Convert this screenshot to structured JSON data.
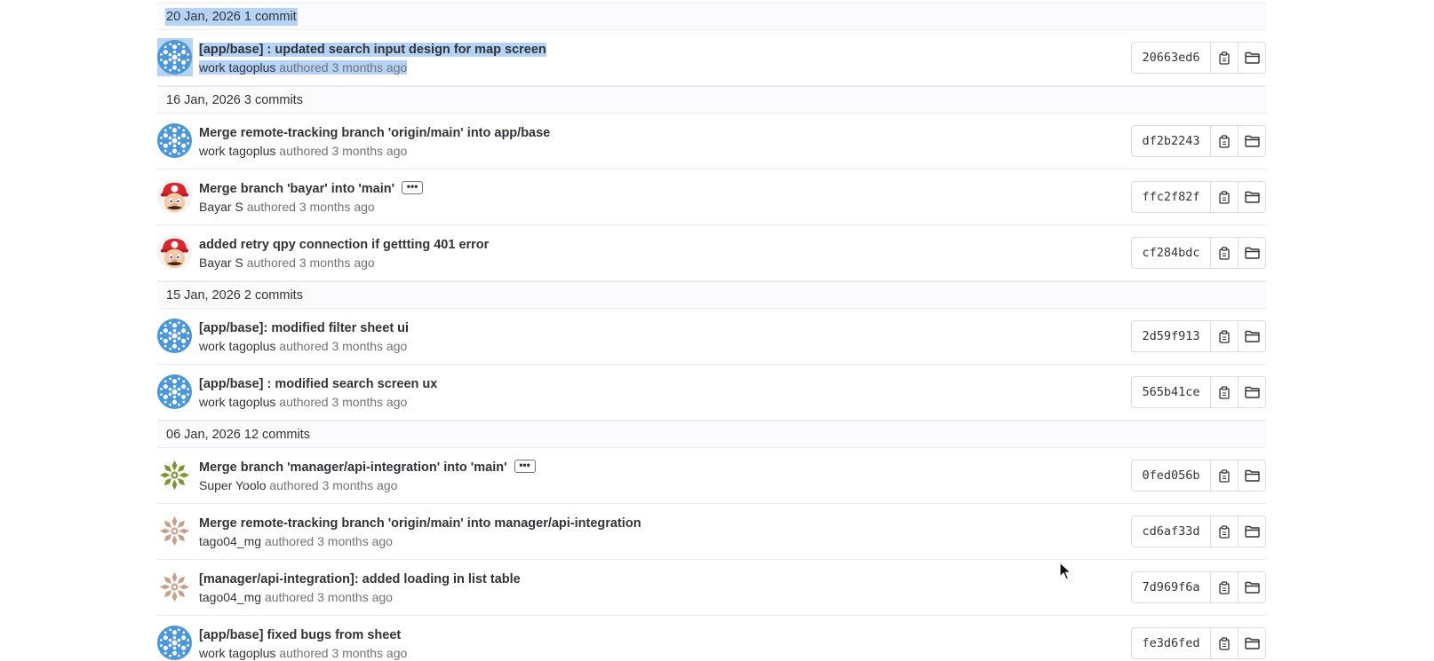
{
  "colors": {
    "selection": "#b4d3f5",
    "avatar_blue": "#4b97d8",
    "avatar_green": "#7d9431",
    "avatar_tan": "#c8a08a",
    "text_primary": "#333238",
    "text_secondary": "#737278"
  },
  "groups": [
    {
      "header": "20 Jan, 2026 1 commit",
      "commits": [
        {
          "title": "[app/base] : updated search input design for map screen",
          "author": "work tagoplus",
          "meta": "authored 3 months ago",
          "sha": "20663ed6",
          "avatar": "blue-snowflake",
          "ellipsis": false,
          "selected": true
        }
      ]
    },
    {
      "header": "16 Jan, 2026 3 commits",
      "commits": [
        {
          "title": "Merge remote-tracking branch 'origin/main' into app/base",
          "author": "work tagoplus",
          "meta": "authored 3 months ago",
          "sha": "df2b2243",
          "avatar": "blue-snowflake",
          "ellipsis": false
        },
        {
          "title": "Merge branch 'bayar' into 'main'",
          "author": "Bayar S",
          "meta": "authored 3 months ago",
          "sha": "ffc2f82f",
          "avatar": "mario",
          "ellipsis": true
        },
        {
          "title": "added retry qpy connection if gettting 401 error",
          "author": "Bayar S",
          "meta": "authored 3 months ago",
          "sha": "cf284bdc",
          "avatar": "mario",
          "ellipsis": false
        }
      ]
    },
    {
      "header": "15 Jan, 2026 2 commits",
      "commits": [
        {
          "title": "[app/base]: modified filter sheet ui",
          "author": "work tagoplus",
          "meta": "authored 3 months ago",
          "sha": "2d59f913",
          "avatar": "blue-snowflake",
          "ellipsis": false
        },
        {
          "title": "[app/base] : modified search screen ux",
          "author": "work tagoplus",
          "meta": "authored 3 months ago",
          "sha": "565b41ce",
          "avatar": "blue-snowflake",
          "ellipsis": false
        }
      ]
    },
    {
      "header": "06 Jan, 2026 12 commits",
      "commits": [
        {
          "title": "Merge branch 'manager/api-integration' into 'main'",
          "author": "Super Yoolo",
          "meta": "authored 3 months ago",
          "sha": "0fed056b",
          "avatar": "green-pattern",
          "ellipsis": true
        },
        {
          "title": "Merge remote-tracking branch 'origin/main' into manager/api-integration",
          "author": "tago04_mg",
          "meta": "authored 3 months ago",
          "sha": "cd6af33d",
          "avatar": "tan-pattern",
          "ellipsis": false
        },
        {
          "title": "[manager/api-integration]: added loading in list table",
          "author": "tago04_mg",
          "meta": "authored 3 months ago",
          "sha": "7d969f6a",
          "avatar": "tan-pattern",
          "ellipsis": false
        },
        {
          "title": "[app/base] fixed bugs from sheet",
          "author": "work tagoplus",
          "meta": "authored 3 months ago",
          "sha": "fe3d6fed",
          "avatar": "blue-snowflake",
          "ellipsis": false
        }
      ]
    }
  ],
  "icons": {
    "copy": "copy-icon",
    "browse": "folder-icon",
    "more": "ellipsis-icon",
    "cursor": "mouse-pointer-icon"
  }
}
